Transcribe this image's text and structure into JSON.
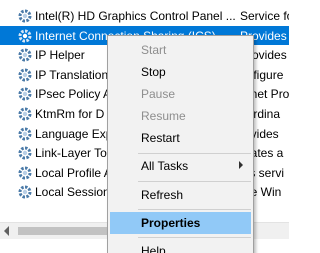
{
  "services": [
    {
      "name": "Intel(R) HD Graphics Control Panel ...",
      "description": "Service fo",
      "selected": false
    },
    {
      "name": "Internet Connection Sharing (ICS)",
      "description": "Provides",
      "selected": true
    },
    {
      "name": "IP Helper",
      "description": "Provides",
      "selected": false
    },
    {
      "name": "IP Translation",
      "description": "onfigure",
      "selected": false
    },
    {
      "name": "IPsec Policy A",
      "description": "ernet Pro",
      "selected": false
    },
    {
      "name": "KtmRm for D",
      "description": "oordina",
      "selected": false
    },
    {
      "name": "Language Exp",
      "description": "rovides",
      "selected": false
    },
    {
      "name": "Link-Layer To",
      "description": "reates a",
      "selected": false
    },
    {
      "name": "Local Profile A",
      "description": "his servi",
      "selected": false
    },
    {
      "name": "Local Session",
      "description": "ore Win",
      "selected": false
    }
  ],
  "context_menu": {
    "items": [
      {
        "label": "Start",
        "disabled": true
      },
      {
        "label": "Stop",
        "disabled": false
      },
      {
        "label": "Pause",
        "disabled": true
      },
      {
        "label": "Resume",
        "disabled": true
      },
      {
        "label": "Restart",
        "disabled": false
      },
      {
        "label": "All Tasks",
        "disabled": false,
        "submenu": true
      },
      {
        "label": "Refresh",
        "disabled": false
      },
      {
        "label": "Properties",
        "disabled": false,
        "bold": true,
        "highlighted": true
      },
      {
        "label": "Help",
        "disabled": false
      }
    ]
  },
  "colors": {
    "selection": "#0078d7",
    "menu_highlight": "#91c9f7",
    "menu_background": "#f2f2f2"
  },
  "icons": {
    "service": "gear-icon",
    "submenu": "chevron-right-icon",
    "scroll_left": "arrow-left-icon"
  }
}
